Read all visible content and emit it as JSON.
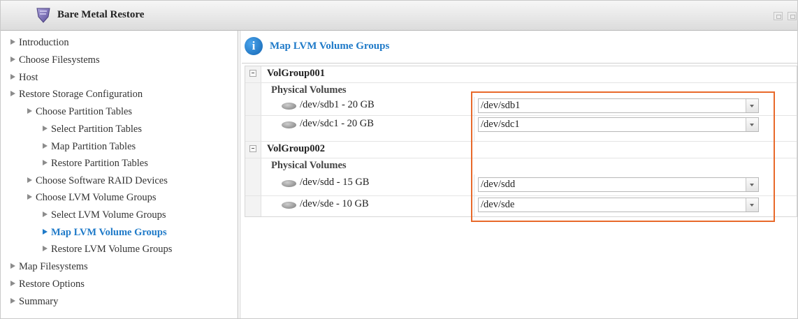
{
  "window": {
    "title": "Bare Metal Restore",
    "accent": "#1f7ac8",
    "highlight_color": "#e8692a"
  },
  "sidebar": {
    "items": [
      {
        "label": "Introduction",
        "level": 0
      },
      {
        "label": "Choose Filesystems",
        "level": 0
      },
      {
        "label": "Host",
        "level": 0
      },
      {
        "label": "Restore Storage Configuration",
        "level": 0
      },
      {
        "label": "Choose Partition Tables",
        "level": 1
      },
      {
        "label": "Select Partition Tables",
        "level": 2
      },
      {
        "label": "Map Partition Tables",
        "level": 2
      },
      {
        "label": "Restore Partition Tables",
        "level": 2
      },
      {
        "label": "Choose Software RAID Devices",
        "level": 1
      },
      {
        "label": "Choose LVM Volume Groups",
        "level": 1
      },
      {
        "label": "Select LVM Volume Groups",
        "level": 2
      },
      {
        "label": "Map LVM Volume Groups",
        "level": 2,
        "active": true
      },
      {
        "label": "Restore LVM Volume Groups",
        "level": 2
      },
      {
        "label": "Map Filesystems",
        "level": 0
      },
      {
        "label": "Restore Options",
        "level": 0
      },
      {
        "label": "Summary",
        "level": 0
      }
    ]
  },
  "main": {
    "title": "Map LVM Volume Groups",
    "icon": "info-icon",
    "groups": [
      {
        "name": "VolGroup001",
        "section_label": "Physical Volumes",
        "volumes": [
          {
            "label": "/dev/sdb1 - 20 GB",
            "selected": "/dev/sdb1"
          },
          {
            "label": "/dev/sdc1 - 20 GB",
            "selected": "/dev/sdc1"
          }
        ]
      },
      {
        "name": "VolGroup002",
        "section_label": "Physical Volumes",
        "volumes": [
          {
            "label": "/dev/sdd - 15 GB",
            "selected": "/dev/sdd"
          },
          {
            "label": "/dev/sde - 10 GB",
            "selected": "/dev/sde"
          }
        ]
      }
    ]
  }
}
